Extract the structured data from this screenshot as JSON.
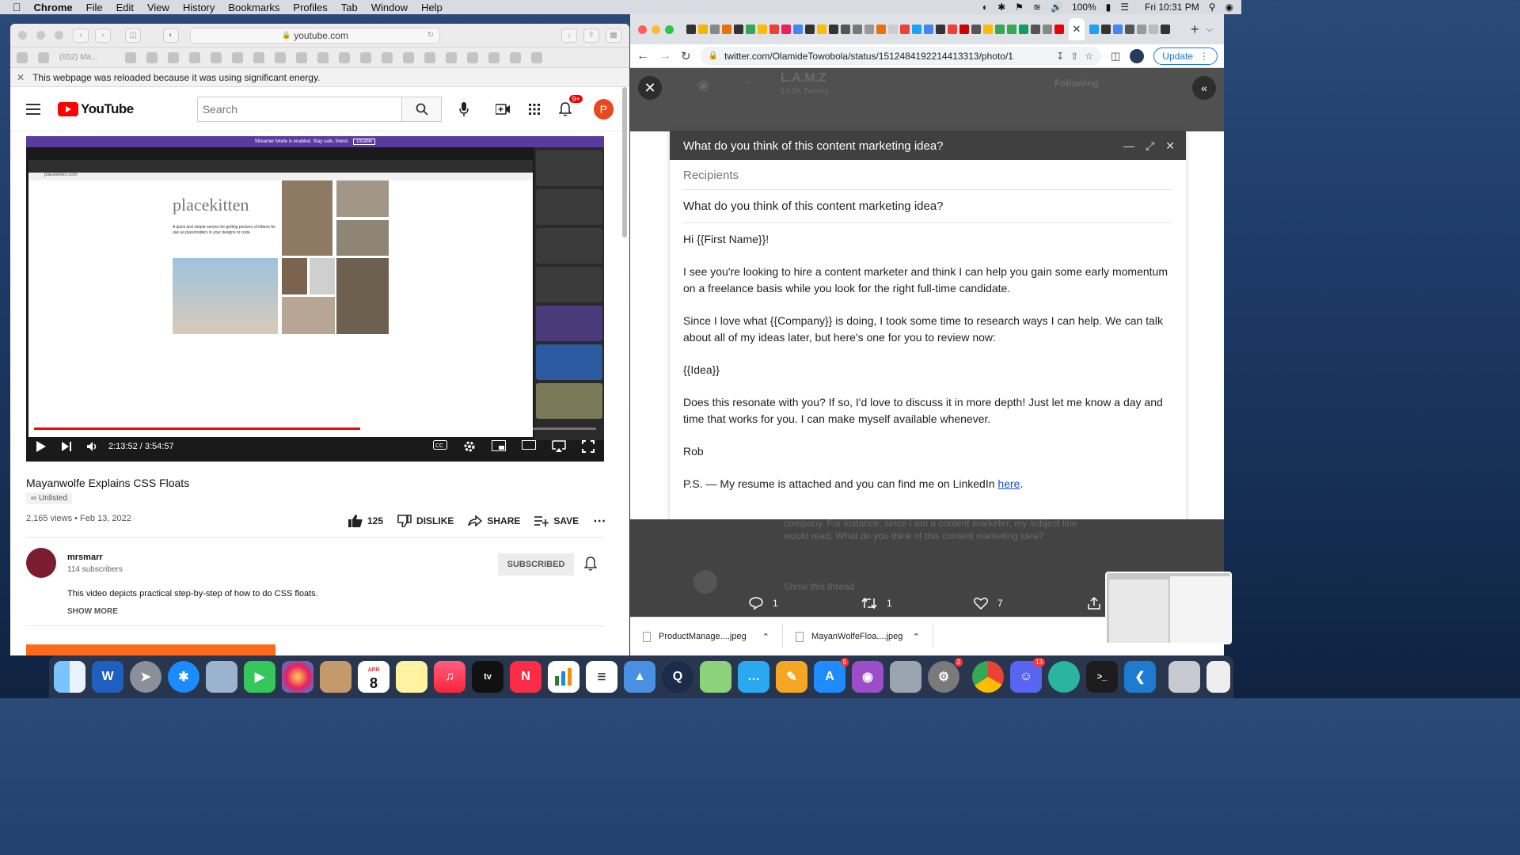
{
  "menubar": {
    "app": "Chrome",
    "items": [
      "File",
      "Edit",
      "View",
      "History",
      "Bookmarks",
      "Profiles",
      "Tab",
      "Window",
      "Help"
    ],
    "battery": "100%",
    "clock": "Fri 10:31 PM"
  },
  "safari": {
    "url": "youtube.com",
    "tab_preview": "(652) Ma...",
    "notice": "This webpage was reloaded because it was using significant energy."
  },
  "youtube": {
    "logo": "YouTube",
    "search_placeholder": "Search",
    "notif_count": "9+",
    "avatar_letter": "P",
    "video": {
      "banner": "Streamer Mode is enabled. Stay safe, friend.",
      "banner_btn": "Disable",
      "site_title": "placekitten",
      "site_desc": "A quick and simple service for getting pictures of kittens for use as placeholders in your designs or code.",
      "time": "2:13:52 / 3:54:57",
      "progress": 0.58
    },
    "title": "Mayanwolfe Explains CSS Floats",
    "visibility": "Unlisted",
    "views": "2,165 views • Feb 13, 2022",
    "actions": {
      "likes": "125",
      "dislike": "DISLIKE",
      "share": "SHARE",
      "save": "SAVE"
    },
    "channel": {
      "name": "mrsmarr",
      "subs": "114 subscribers",
      "subscribed": "SUBSCRIBED"
    },
    "description": "This video depicts practical step-by-step of how to do CSS floats.",
    "show_more": "SHOW MORE"
  },
  "chrome": {
    "url": "twitter.com/OlamideTowobola/status/1512484192214413313/photo/1",
    "update": "Update",
    "twitter": {
      "name": "L.A.M.Z",
      "tweets": "14.1K Tweets",
      "following": "Following",
      "below_text_1": "company. For instance, since I am a content marketer, my subject line",
      "below_text_2": "would read: What do you think of this content marketing idea?",
      "show_thread": "Show this thread",
      "replies": "1",
      "retweets": "1",
      "likes": "7"
    },
    "email": {
      "header": "What do you think of this content marketing idea?",
      "recipients": "Recipients",
      "subject": "What do you think of this content marketing idea?",
      "greeting": "Hi {{First Name}}!",
      "p1": "I see you're looking to hire a content marketer and think I can help you gain some early momentum on a freelance basis while you look for the right full-time candidate.",
      "p2": "Since I love what {{Company}} is doing, I took some time to research ways I can help. We can talk about all of my ideas later, but here's one for you to review now:",
      "p3": "{{Idea}}",
      "p4": "Does this resonate with you? If so, I'd love to discuss it in more depth! Just let me know a day and time that works for you. I can make myself available whenever.",
      "sign": "Rob",
      "ps": "P.S. — My resume is attached and you can find me on LinkedIn ",
      "ps_link": "here",
      "ps_end": "."
    },
    "downloads": [
      "ProductManage....jpeg",
      "MayanWolfeFloa....jpeg"
    ]
  },
  "dock": {
    "calendar_month": "APR",
    "calendar_day": "8",
    "appstore_badge": "5",
    "sysprefs_badge": "2",
    "discord_badge": "13"
  }
}
